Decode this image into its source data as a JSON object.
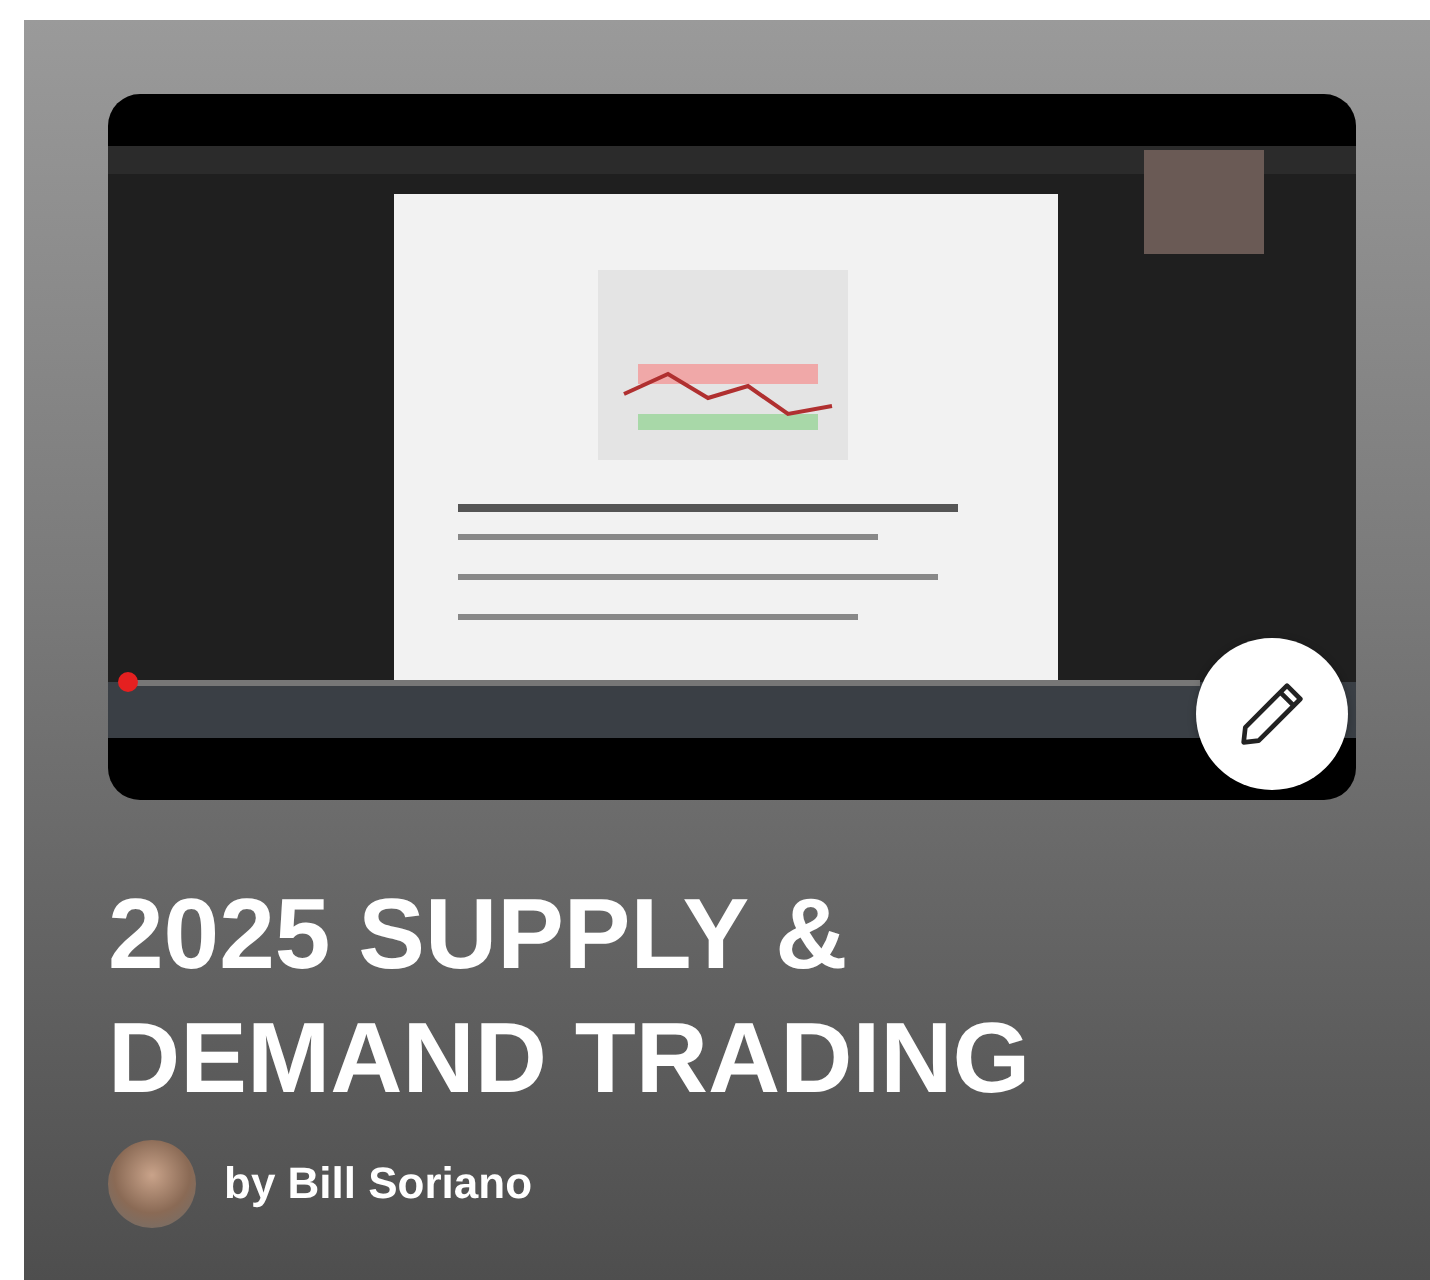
{
  "title": "2025 SUPPLY & DEMAND TRADING",
  "author": "by Bill Soriano"
}
